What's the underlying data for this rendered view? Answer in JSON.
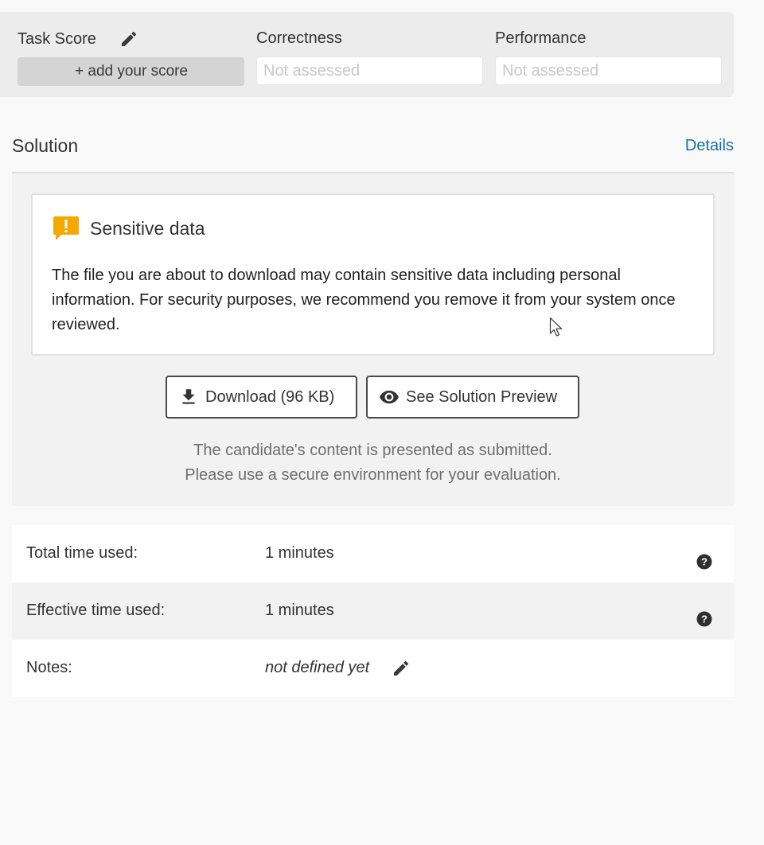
{
  "score": {
    "task_score_label": "Task Score",
    "add_score_label": "+ add your score",
    "correctness_label": "Correctness",
    "correctness_placeholder": "Not assessed",
    "performance_label": "Performance",
    "performance_placeholder": "Not assessed"
  },
  "solution": {
    "title": "Solution",
    "details_link": "Details",
    "warning": {
      "title": "Sensitive data",
      "text": "The file you are about to download may contain sensitive data including personal information. For security purposes, we recommend you remove it from your system once reviewed."
    },
    "download_label": "Download (96 KB)",
    "preview_label": "See Solution Preview",
    "notice_line1": "The candidate's content is presented as submitted.",
    "notice_line2": "Please use a secure environment for your evaluation."
  },
  "info": {
    "total_time_label": "Total time used:",
    "total_time_value": "1 minutes",
    "effective_time_label": "Effective time used:",
    "effective_time_value": "1 minutes",
    "notes_label": "Notes:",
    "notes_value": "not defined yet"
  },
  "colors": {
    "accent_link": "#1a6fa3",
    "warning_icon": "#f5a800"
  }
}
